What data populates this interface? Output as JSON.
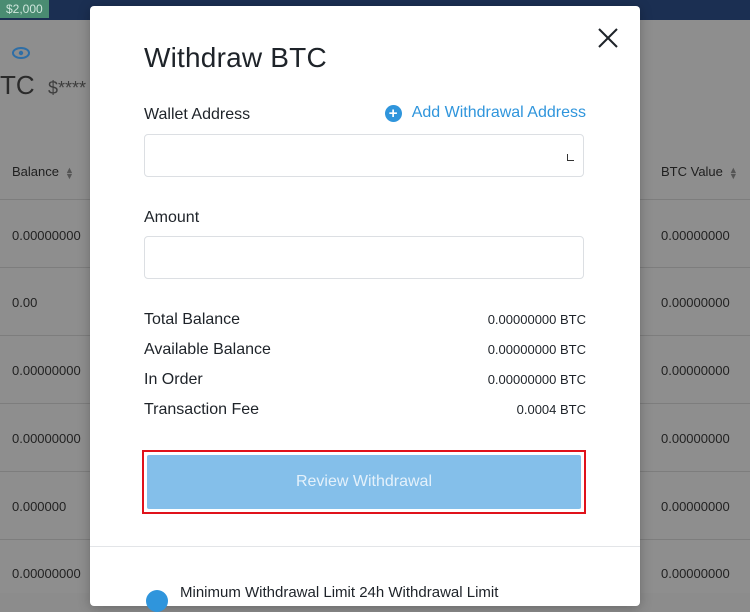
{
  "background": {
    "badge": "$2,000",
    "coin_ticker_partial": "TC",
    "masked_value": "$****",
    "columns": {
      "balance": "Balance",
      "btc_value": "BTC Value"
    },
    "rows": [
      {
        "balance": "0.00000000",
        "btc_value": "0.00000000"
      },
      {
        "balance": "0.00",
        "btc_value": "0.00000000"
      },
      {
        "balance": "0.00000000",
        "btc_value": "0.00000000"
      },
      {
        "balance": "0.00000000",
        "btc_value": "0.00000000"
      },
      {
        "balance": "0.000000",
        "btc_value": "0.00000000"
      },
      {
        "balance": "0.00000000",
        "btc_value": "0.00000000"
      }
    ]
  },
  "modal": {
    "title": "Withdraw BTC",
    "wallet_address_label": "Wallet Address",
    "add_withdrawal_address": "Add Withdrawal Address",
    "wallet_address_value": "",
    "amount_label": "Amount",
    "amount_value": "",
    "summary": [
      {
        "label": "Total Balance",
        "value": "0.00000000 BTC"
      },
      {
        "label": "Available Balance",
        "value": "0.00000000 BTC"
      },
      {
        "label": "In Order",
        "value": "0.00000000 BTC"
      },
      {
        "label": "Transaction Fee",
        "value": "0.0004 BTC"
      }
    ],
    "review_button": "Review Withdrawal",
    "footer_partial": "Minimum Withdrawal Limit        24h Withdrawal Limit"
  },
  "colors": {
    "accent": "#2f95dc",
    "button_disabled": "#84bfea",
    "highlight": "#e0121b"
  }
}
